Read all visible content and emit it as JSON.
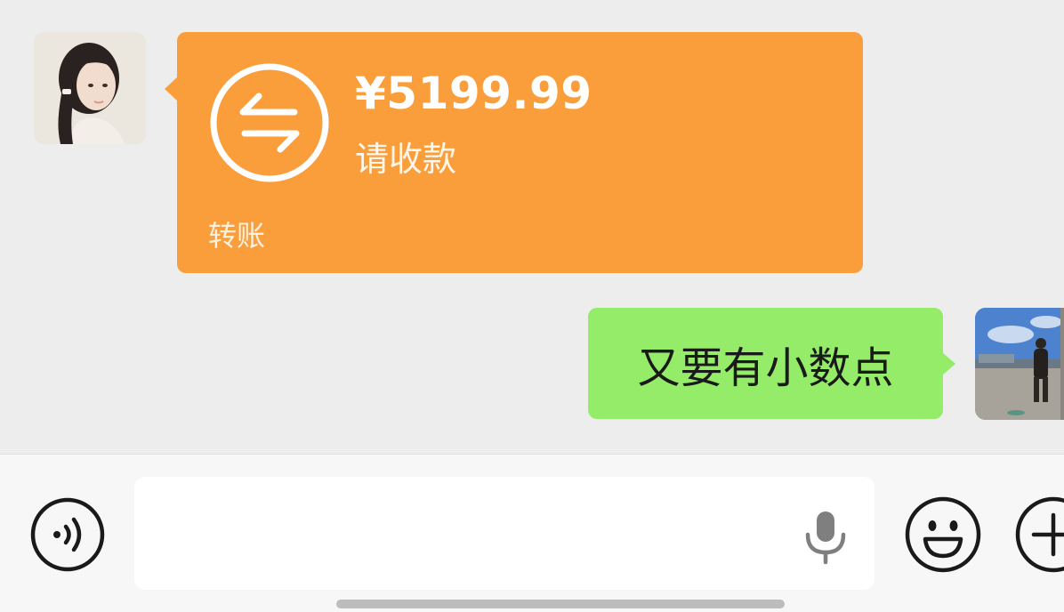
{
  "messages": {
    "received": {
      "sender_avatar": "girl-portrait-avatar",
      "transfer": {
        "amount": "¥5199.99",
        "status": "请收款",
        "type_label": "转账",
        "icon": "transfer-arrows-icon",
        "bubble_color": "#fa9e3b"
      }
    },
    "sent": {
      "sender_avatar": "outdoor-photo-avatar",
      "text": "又要有小数点",
      "bubble_color": "#95ec69"
    }
  },
  "input_bar": {
    "voice_toggle_icon": "voice-mode-icon",
    "text_value": "",
    "mic_icon": "microphone-icon",
    "emoji_icon": "emoji-face-icon",
    "plus_icon": "plus-circle-icon"
  },
  "colors": {
    "background": "#ededed",
    "input_bar_bg": "#f7f7f7",
    "icon_stroke": "#1a1a1a"
  }
}
